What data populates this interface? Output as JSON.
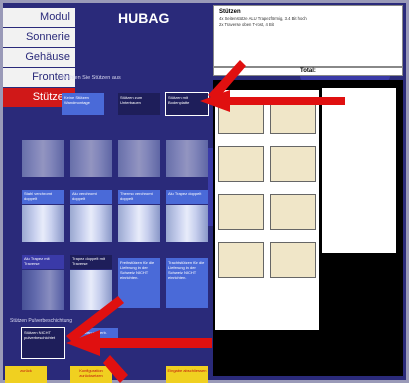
{
  "nav": {
    "items": [
      {
        "label": "Modul",
        "active": false
      },
      {
        "label": "Sonnerie",
        "active": false
      },
      {
        "label": "Gehäuse",
        "active": false
      },
      {
        "label": "Fronten",
        "active": false
      },
      {
        "label": "Stützen",
        "active": true
      }
    ]
  },
  "header": {
    "logo": "HUBAG"
  },
  "main": {
    "prompt": "Wählen Sie Stützen aus",
    "top_buttons": [
      {
        "label": "Keine Stützen Wandmontage"
      },
      {
        "label": "Stützen zum Unterbauen"
      },
      {
        "label": "Stützen mit Bodenplatte"
      }
    ],
    "row2_labels": [
      "Stahl verchromt doppelt",
      "Alu verchromt doppelt",
      "Thermo verchromt doppelt",
      "Alu Trapez doppelt"
    ],
    "row3_labels": [
      "Alu Trapez mit Traverse",
      "Trapez doppelt mit Traverse"
    ],
    "notes": [
      "Freihstützen für die Lieferung in der Schweiz NICHT einrichten.",
      "Trachtstützen für die Lieferung in der Schweiz NICHT einrichten."
    ],
    "powder_section_label": "Stützen Pulverbeschichtung",
    "powder_options": [
      {
        "label": "Stützen NICHT pulverbeschichtet"
      },
      {
        "label": "Stützen pulverb."
      }
    ]
  },
  "summary": {
    "title": "Stützen",
    "lines": [
      "4x Seitenstütze ALU Trapezförmig, 3.4 Bit hoch",
      "2x Traverse oben T-rost, 4 Bit"
    ],
    "total_label": "Total:"
  },
  "footer": {
    "back": "zurück",
    "middle": "Konfiguration zurücksetzen",
    "save": "Eingabe abschliessen"
  },
  "colors": {
    "background": "#2a2a7a",
    "accent_red": "#e01010",
    "button_blue": "#4a6ad8",
    "footer_yellow": "#f0d020"
  }
}
